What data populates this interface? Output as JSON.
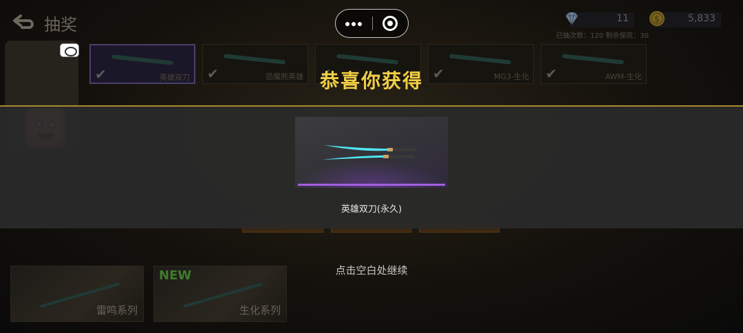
{
  "header": {
    "title": "抽奖",
    "diamonds": "11",
    "gold": "5,833",
    "draw_info": "已抽次数：120   剩余保底：30"
  },
  "slots": [
    {
      "name": "英雄双刀",
      "state": "active"
    },
    {
      "name": "恐魔熊英雄",
      "state": "normal"
    },
    {
      "name": "",
      "state": "normal"
    },
    {
      "name": "MG3-生化",
      "state": "normal"
    },
    {
      "name": "AWM-生化",
      "state": "normal"
    }
  ],
  "series": [
    {
      "label": "雷鸣系列",
      "new": ""
    },
    {
      "label": "生化系列",
      "new": "NEW"
    }
  ],
  "reward": {
    "title": "恭喜你获得",
    "item_name": "英雄双刀(永久)",
    "rarity_color": "#a45fe0"
  },
  "hint": "点击空白处继续",
  "colors": {
    "accent_gold": "#f2cf45",
    "band_border": "#a88b2c"
  },
  "icons": {
    "back": "back-arrow-icon",
    "diamond": "diamond-icon",
    "gold": "gold-coin-icon",
    "more": "more-dots-icon",
    "close": "close-target-icon"
  }
}
